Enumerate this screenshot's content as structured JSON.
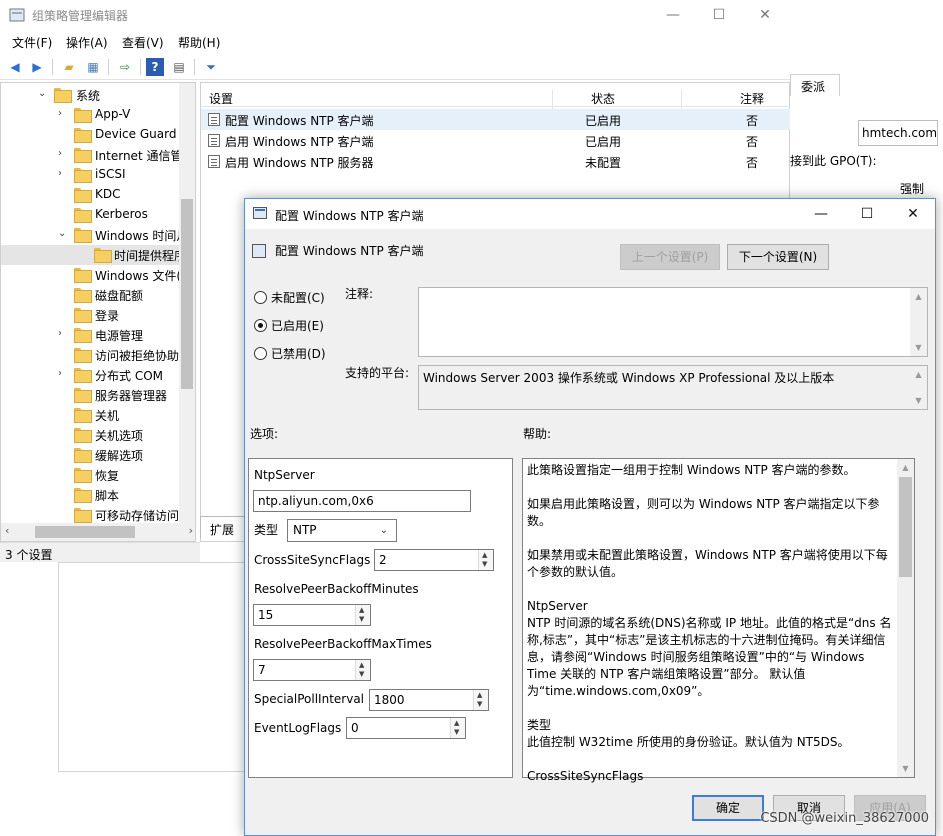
{
  "main": {
    "title": "组策略管理编辑器",
    "window_controls": [
      "—",
      "☐",
      "✕"
    ],
    "menu": [
      "文件(F)",
      "操作(A)",
      "查看(V)",
      "帮助(H)"
    ],
    "status": "3 个设置",
    "extended_tab": "扩展"
  },
  "tree": {
    "items": [
      {
        "label": "系统",
        "expander": "⌄"
      },
      {
        "label": "App-V",
        "expander": "›"
      },
      {
        "label": "Device Guard",
        "expander": ""
      },
      {
        "label": "Internet 通信管",
        "expander": "›"
      },
      {
        "label": "iSCSI",
        "expander": "›"
      },
      {
        "label": "KDC",
        "expander": ""
      },
      {
        "label": "Kerberos",
        "expander": ""
      },
      {
        "label": "Windows 时间月",
        "expander": "⌄"
      },
      {
        "label": "时间提供程序",
        "expander": ""
      },
      {
        "label": "Windows 文件(",
        "expander": ""
      },
      {
        "label": "磁盘配额",
        "expander": ""
      },
      {
        "label": "登录",
        "expander": ""
      },
      {
        "label": "电源管理",
        "expander": "›"
      },
      {
        "label": "访问被拒绝协助",
        "expander": ""
      },
      {
        "label": "分布式 COM",
        "expander": "›"
      },
      {
        "label": "服务器管理器",
        "expander": ""
      },
      {
        "label": "关机",
        "expander": ""
      },
      {
        "label": "关机选项",
        "expander": ""
      },
      {
        "label": "缓解选项",
        "expander": ""
      },
      {
        "label": "恢复",
        "expander": ""
      },
      {
        "label": "脚本",
        "expander": ""
      },
      {
        "label": "可移动存储访问",
        "expander": ""
      }
    ]
  },
  "list": {
    "headers": {
      "setting": "设置",
      "state": "状态",
      "comment": "注释"
    },
    "rows": [
      {
        "name": "配置 Windows NTP 客户端",
        "state": "已启用",
        "comment": "否"
      },
      {
        "name": "启用 Windows NTP 客户端",
        "state": "已启用",
        "comment": "否"
      },
      {
        "name": "启用 Windows NTP 服务器",
        "state": "未配置",
        "comment": "否"
      }
    ]
  },
  "background": {
    "tab": "委派",
    "input_value": "hmtech.com",
    "link_text": "接到此 GPO(T):",
    "column": "强制"
  },
  "dialog": {
    "title": "配置 Windows NTP 客户端",
    "header_title": "配置 Windows NTP 客户端",
    "prev_button": "上一个设置(P)",
    "next_button": "下一个设置(N)",
    "radios": [
      {
        "label": "未配置(C)",
        "checked": false
      },
      {
        "label": "已启用(E)",
        "checked": true
      },
      {
        "label": "已禁用(D)",
        "checked": false
      }
    ],
    "comment_label": "注释:",
    "comment_value": "",
    "platform_label": "支持的平台:",
    "platform_value": "Windows Server 2003 操作系统或 Windows XP Professional 及以上版本",
    "options_label": "选项:",
    "help_label": "帮助:",
    "options": {
      "ntpserver_label": "NtpServer",
      "ntpserver_value": "ntp.aliyun.com,0x6",
      "type_label": "类型",
      "type_value": "NTP",
      "crosssite_label": "CrossSiteSyncFlags",
      "crosssite_value": "2",
      "backoff_min_label": "ResolvePeerBackoffMinutes",
      "backoff_min_value": "15",
      "backoff_max_label": "ResolvePeerBackoffMaxTimes",
      "backoff_max_value": "7",
      "poll_label": "SpecialPollInterval",
      "poll_value": "1800",
      "eventlog_label": "EventLogFlags",
      "eventlog_value": "0"
    },
    "help_paragraphs": [
      "此策略设置指定一组用于控制 Windows NTP 客户端的参数。",
      "如果启用此策略设置，则可以为 Windows NTP 客户端指定以下参数。",
      "如果禁用或未配置此策略设置，Windows NTP 客户端将使用以下每个参数的默认值。",
      "NtpServer\nNTP 时间源的域名系统(DNS)名称或 IP 地址。此值的格式是“dns 名称,标志”，其中“标志”是该主机标志的十六进制位掩码。有关详细信息，请参阅“Windows 时间服务组策略设置”中的“与 Windows Time 关联的 NTP 客户端组策略设置”部分。 默认值为“time.windows.com,0x09”。",
      "类型\n此值控制 W32time 所使用的身份验证。默认值为 NT5DS。",
      "CrossSiteSyncFlags"
    ],
    "ok_button": "确定",
    "cancel_button": "取消",
    "apply_button": "应用(A)"
  },
  "watermark": "CSDN @weixin_38627000",
  "colors": {
    "accent": "#3d7bd6",
    "selection": "#e5f0fb",
    "folder": "#f5cf61"
  }
}
